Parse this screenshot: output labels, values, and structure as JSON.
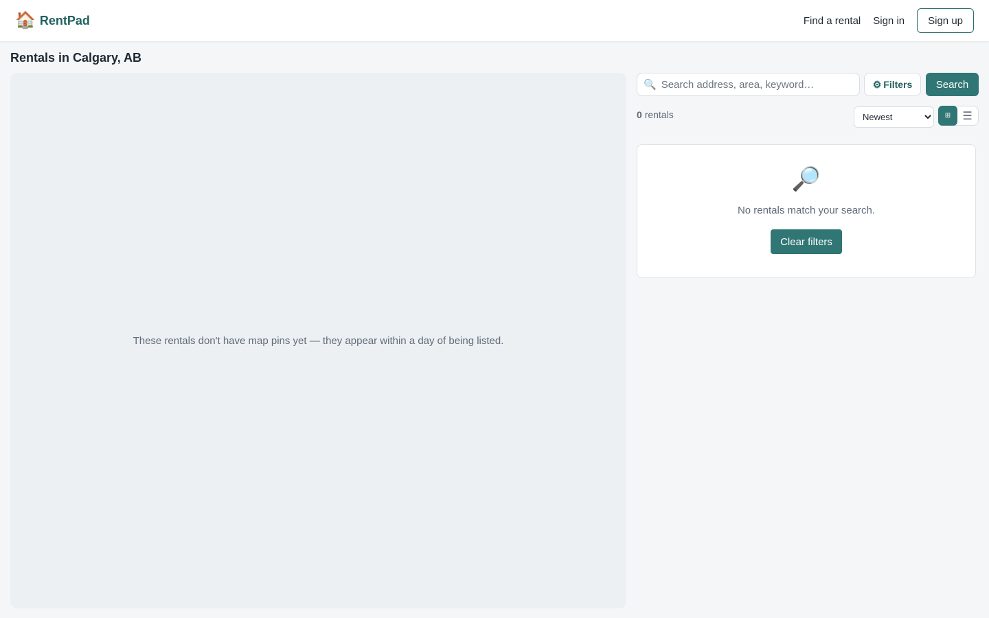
{
  "header": {
    "brand_icon": "🏠",
    "brand_name": "RentPad",
    "nav_find": "Find a rental",
    "nav_signin": "Sign in",
    "signup_label": "Sign up"
  },
  "page": {
    "title": "Rentals in Calgary, AB"
  },
  "map": {
    "message": "These rentals don't have map pins yet — they appear within a day of being listed."
  },
  "search": {
    "icon": "🔍",
    "placeholder": "Search address, area, keyword…",
    "value": "",
    "filters_icon": "⚙",
    "filters_label": "Filters",
    "search_label": "Search"
  },
  "results": {
    "count": "0",
    "count_suffix": "rentals",
    "sort_selected": "Newest",
    "view_grid_icon": "⊞",
    "view_list_icon": "☰"
  },
  "empty_state": {
    "icon": "🔎",
    "message": "No rentals match your search.",
    "clear_label": "Clear filters"
  },
  "colors": {
    "brand": "#22625f",
    "accent": "#2f7674",
    "background": "#f4f6f8"
  }
}
